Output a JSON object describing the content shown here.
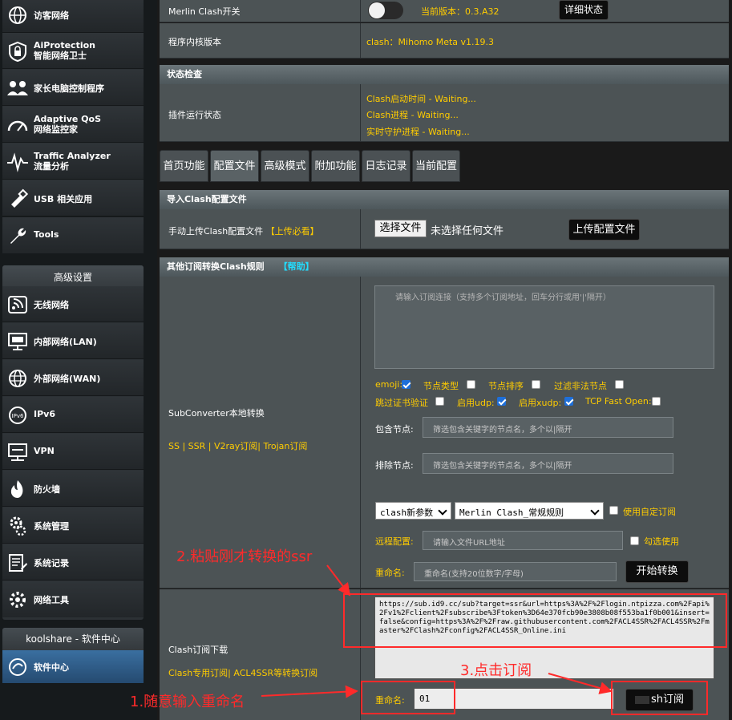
{
  "sidebar": {
    "top_items": [
      {
        "icon": "globe-icon",
        "label": "访客网络"
      },
      {
        "icon": "lock-icon",
        "label": "AiProtection",
        "label2": "智能网络卫士"
      },
      {
        "icon": "family-icon",
        "label": "家长电脑控制程序"
      },
      {
        "icon": "speedometer-icon",
        "label": "Adaptive QoS",
        "label2": "网络监控家"
      },
      {
        "icon": "traffic-icon",
        "label": "Traffic Analyzer",
        "label2": "流量分析"
      },
      {
        "icon": "usb-icon",
        "label": "USB 相关应用"
      },
      {
        "icon": "wrench-icon",
        "label": "Tools"
      }
    ],
    "advanced_title": "高级设置",
    "advanced_items": [
      {
        "icon": "wifi-icon",
        "label": "无线网络"
      },
      {
        "icon": "lan-icon",
        "label": "内部网络(LAN)"
      },
      {
        "icon": "wan-icon",
        "label": "外部网络(WAN)"
      },
      {
        "icon": "ipv6-icon",
        "label": "IPv6"
      },
      {
        "icon": "vpn-icon",
        "label": "VPN"
      },
      {
        "icon": "firewall-icon",
        "label": "防火墙"
      },
      {
        "icon": "admin-icon",
        "label": "系统管理"
      },
      {
        "icon": "log-icon",
        "label": "系统记录"
      },
      {
        "icon": "network-tools-icon",
        "label": "网络工具"
      }
    ],
    "koolshare_title": "koolshare - 软件中心",
    "software_center": "软件中心"
  },
  "main": {
    "switch_label": "Merlin Clash开关",
    "version_label": "当前版本：0.3.A32",
    "detail_button": "详细状态",
    "kernel_label": "程序内核版本",
    "kernel_value": "clash：Mihomo Meta v1.19.3",
    "status_header": "状态检查",
    "plugin_status_label": "插件运行状态",
    "status_lines": [
      "Clash启动时间 - Waiting...",
      "Clash进程 - Waiting...",
      "实时守护进程 - Waiting..."
    ],
    "tabs": [
      "首页功能",
      "配置文件",
      "高级模式",
      "附加功能",
      "日志记录",
      "当前配置"
    ],
    "import_header": "导入Clash配置文件",
    "manual_upload_label": "手动上传Clash配置文件",
    "upload_note": "【上传必看】",
    "choose_file_button": "选择文件",
    "no_file_text": "未选择任何文件",
    "upload_button": "上传配置文件",
    "other_header": "其他订阅转换Clash规则",
    "help_link": "【帮助】",
    "subconv_label": "SubConverter本地转换",
    "subconv_links": "SS | SSR | V2ray订阅| Trojan订阅",
    "sub_placeholder": "请输入订阅连接（支持多个订阅地址，回车分行或用'|'隔开）",
    "options_row1": [
      {
        "label": "emoji:",
        "checked": true
      },
      {
        "label": "节点类型",
        "checked": false
      },
      {
        "label": "节点排序",
        "checked": false
      },
      {
        "label": "过滤非法节点",
        "checked": false
      }
    ],
    "options_row2": [
      {
        "label": "跳过证书验证",
        "checked": false
      },
      {
        "label": "启用udp:",
        "checked": true
      },
      {
        "label": "启用xudp:",
        "checked": true
      },
      {
        "label": "TCP Fast Open:",
        "checked": false
      }
    ],
    "include_label": "包含节点:",
    "include_placeholder": "筛选包含关键字的节点名，多个以|隔开",
    "exclude_label": "排除节点:",
    "exclude_placeholder": "筛选包含关键字的节点名，多个以|隔开",
    "select1": "clash新参数",
    "select2": "Merlin Clash_常规规则",
    "custom_sub_label": "使用自定订阅",
    "remote_label": "远程配置:",
    "remote_placeholder": "请输入文件URL地址",
    "tick_use_label": "勾选使用",
    "rename_label": "重命名:",
    "rename_placeholder": "重命名(支持20位数字/字母)",
    "start_convert_button": "开始转换",
    "download_label": "Clash订阅下载",
    "download_links": "Clash专用订阅| ACL4SSR等转换订阅",
    "sub_url": "https://sub.id9.cc/sub?target=ssr&url=https%3A%2F%2Flogin.ntpizza.com%2Fapi%2Fv1%2Fclient%2Fsubscribe%3Ftoken%3D64e370fcb90e3808b08f553ba1f0b001&insert=false&config=https%3A%2F%2Fraw.githubusercontent.com%2FACL4SSR%2FACL4SSR%2Fmaster%2FClash%2Fconfig%2FACL4SSR_Online.ini",
    "rename2_label": "重命名:",
    "rename2_value": "01",
    "subscribe_button": "sh订阅"
  },
  "annotations": {
    "step1": "1.随意输入重命名",
    "step2": "2.粘贴刚才转换的ssr",
    "step3": "3.点击订阅"
  },
  "colors": {
    "accent_yellow": "#ffcc00",
    "help_cyan": "#22ddff",
    "annotation_red": "#ff2a2a"
  }
}
